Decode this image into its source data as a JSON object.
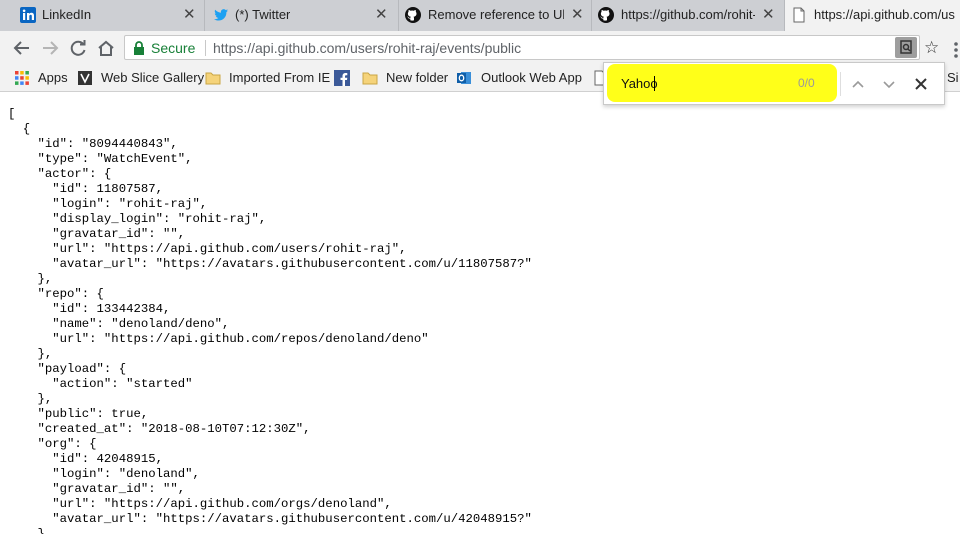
{
  "tabs": [
    {
      "title": "LinkedIn",
      "icon": "linkedin-icon"
    },
    {
      "title": "(*) Twitter",
      "icon": "twitter-icon"
    },
    {
      "title": "Remove reference to Ubu",
      "icon": "github-icon"
    },
    {
      "title": "https://github.com/rohit-",
      "icon": "github-icon"
    },
    {
      "title": "https://api.github.com/us",
      "icon": "page-icon"
    }
  ],
  "address": {
    "secure_label": "Secure",
    "scheme_host": "https://api.github.com",
    "path": "/users/rohit-raj/events/public"
  },
  "bookmarks": [
    {
      "label": "Apps",
      "icon": "apps-grid-icon"
    },
    {
      "label": "Web Slice Gallery",
      "icon": "web-slice-icon"
    },
    {
      "label": "Imported From IE",
      "icon": "folder-icon"
    },
    {
      "label": "",
      "icon": "facebook-icon"
    },
    {
      "label": "New folder",
      "icon": "folder-icon"
    },
    {
      "label": "Outlook Web App",
      "icon": "outlook-icon"
    },
    {
      "label": "Si",
      "icon": "page-icon"
    }
  ],
  "find": {
    "query": "Yahoo",
    "count": "0/0"
  },
  "json_text": "[\n  {\n    \"id\": \"8094440843\",\n    \"type\": \"WatchEvent\",\n    \"actor\": {\n      \"id\": 11807587,\n      \"login\": \"rohit-raj\",\n      \"display_login\": \"rohit-raj\",\n      \"gravatar_id\": \"\",\n      \"url\": \"https://api.github.com/users/rohit-raj\",\n      \"avatar_url\": \"https://avatars.githubusercontent.com/u/11807587?\"\n    },\n    \"repo\": {\n      \"id\": 133442384,\n      \"name\": \"denoland/deno\",\n      \"url\": \"https://api.github.com/repos/denoland/deno\"\n    },\n    \"payload\": {\n      \"action\": \"started\"\n    },\n    \"public\": true,\n    \"created_at\": \"2018-08-10T07:12:30Z\",\n    \"org\": {\n      \"id\": 42048915,\n      \"login\": \"denoland\",\n      \"gravatar_id\": \"\",\n      \"url\": \"https://api.github.com/orgs/denoland\",\n      \"avatar_url\": \"https://avatars.githubusercontent.com/u/42048915?\"\n    }\n  },"
}
